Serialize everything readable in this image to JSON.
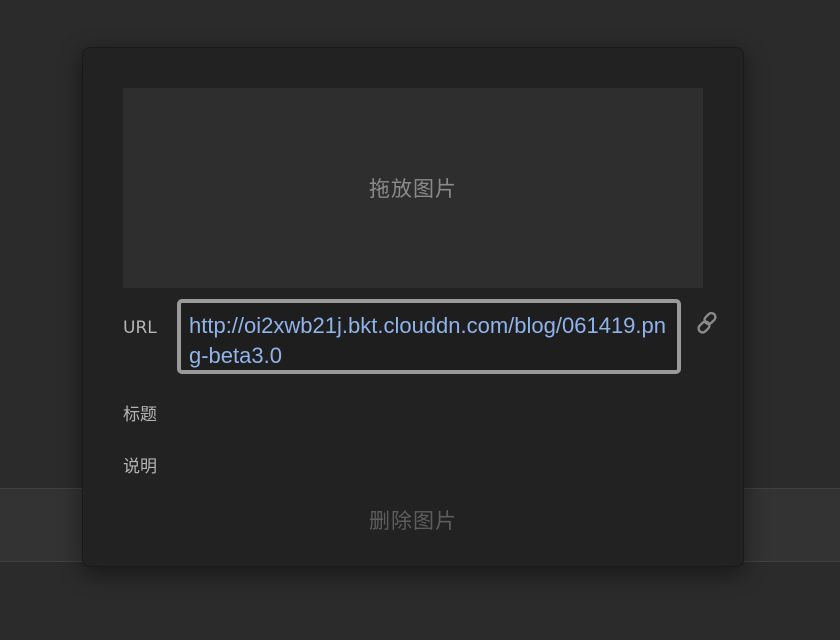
{
  "image_dialog": {
    "drop_zone_label": "拖放图片",
    "url_label": "URL",
    "url_value": "http://oi2xwb21j.bkt.clouddn.com/blog/061419.png-beta3.0",
    "title_label": "标题",
    "title_value": "",
    "caption_label": "说明",
    "caption_value": "",
    "delete_label": "删除图片",
    "link_icon": "link-icon"
  },
  "colors": {
    "background": "#2b2b2b",
    "dialog": "#222222",
    "drop_zone": "#2e2e2e",
    "url_text": "#8fb3ea",
    "url_border": "#9a9a9a",
    "label_text": "#b5b5b5",
    "delete_text": "#5d5d5d"
  }
}
